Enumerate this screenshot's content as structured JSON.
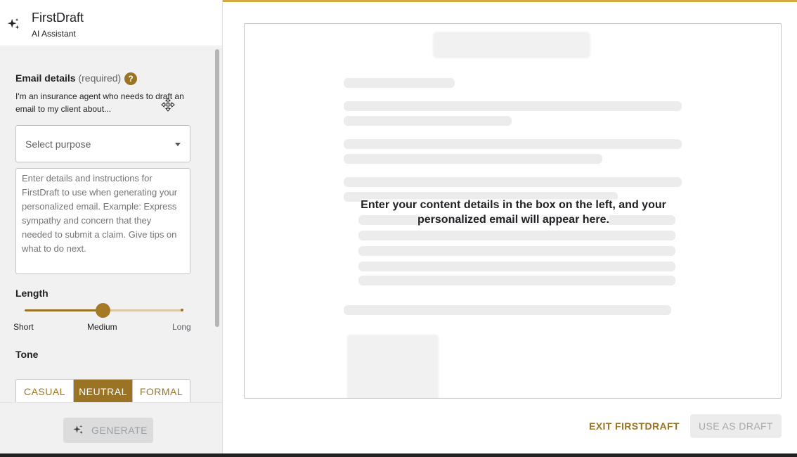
{
  "app": {
    "title": "FirstDraft",
    "subtitle": "AI Assistant",
    "icon": "sparkle-icon"
  },
  "email_details": {
    "label": "Email details",
    "required_note": "(required)",
    "help_glyph": "?",
    "intro": "I'm an insurance agent who needs to draft an email to my client about...",
    "purpose_select": {
      "selected": "Select purpose"
    },
    "instructions_placeholder": "Enter details and instructions for FirstDraft to use when generating your personalized email. Example: Express sympathy and concern that they needed to submit a claim. Give tips on what to do next."
  },
  "length": {
    "label": "Length",
    "options": [
      "Short",
      "Medium",
      "Long"
    ],
    "selected": "Medium",
    "level": 0.5
  },
  "tone": {
    "label": "Tone",
    "options": [
      "CASUAL",
      "NEUTRAL",
      "FORMAL"
    ],
    "selected": "NEUTRAL"
  },
  "generate_label": "GENERATE",
  "preview": {
    "message_line1": "Enter your content details in the box on the left, and your",
    "message_line2": "personalized email will appear here."
  },
  "actions": {
    "exit_label": "EXIT FIRSTDRAFT",
    "use_label": "USE AS DRAFT"
  },
  "colors": {
    "accent": "#9a7424",
    "top_border": "#d4a940",
    "disabled": "#dcdcdc"
  }
}
